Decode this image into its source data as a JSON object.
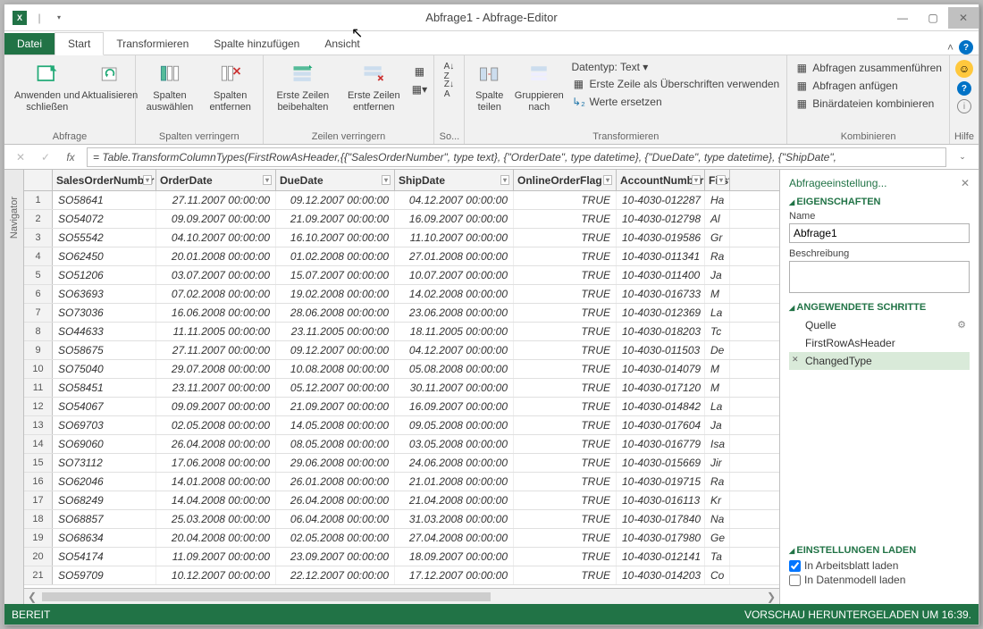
{
  "title": "Abfrage1 - Abfrage-Editor",
  "tabs": {
    "file": "Datei",
    "start": "Start",
    "transform": "Transformieren",
    "addcol": "Spalte hinzufügen",
    "view": "Ansicht"
  },
  "ribbon": {
    "group1": {
      "label": "Abfrage",
      "apply": "Anwenden\nund schließen",
      "refresh": "Aktualisieren"
    },
    "group2": {
      "label": "Spalten verringern",
      "choose": "Spalten\nauswählen",
      "remove": "Spalten\nentfernen"
    },
    "group3": {
      "label": "Zeilen verringern",
      "keep": "Erste Zeilen\nbeibehalten",
      "del": "Erste Zeilen\nentfernen"
    },
    "group4": {
      "label": "So..."
    },
    "group5": {
      "label": "Transformieren",
      "split": "Spalte\nteilen",
      "group": "Gruppieren\nnach",
      "dtype": "Datentyp: Text ▾",
      "firstrow": "Erste Zeile als Überschriften verwenden",
      "replace": "Werte ersetzen"
    },
    "group6": {
      "label": "Kombinieren",
      "merge": "Abfragen zusammenführen",
      "append": "Abfragen anfügen",
      "binary": "Binärdateien kombinieren"
    },
    "group7": {
      "label": "Hilfe"
    }
  },
  "formula": "= Table.TransformColumnTypes(FirstRowAsHeader,{{\"SalesOrderNumber\", type text}, {\"OrderDate\", type datetime}, {\"DueDate\", type datetime}, {\"ShipDate\",",
  "nav": "Navigator",
  "cols": [
    "SalesOrderNumber",
    "OrderDate",
    "DueDate",
    "ShipDate",
    "OnlineOrderFlag",
    "AccountNumber",
    "FirstN"
  ],
  "rows": [
    [
      "SO58641",
      "27.11.2007 00:00:00",
      "09.12.2007 00:00:00",
      "04.12.2007 00:00:00",
      "TRUE",
      "10-4030-012287",
      "Ha"
    ],
    [
      "SO54072",
      "09.09.2007 00:00:00",
      "21.09.2007 00:00:00",
      "16.09.2007 00:00:00",
      "TRUE",
      "10-4030-012798",
      "Al"
    ],
    [
      "SO55542",
      "04.10.2007 00:00:00",
      "16.10.2007 00:00:00",
      "11.10.2007 00:00:00",
      "TRUE",
      "10-4030-019586",
      "Gr"
    ],
    [
      "SO62450",
      "20.01.2008 00:00:00",
      "01.02.2008 00:00:00",
      "27.01.2008 00:00:00",
      "TRUE",
      "10-4030-011341",
      "Ra"
    ],
    [
      "SO51206",
      "03.07.2007 00:00:00",
      "15.07.2007 00:00:00",
      "10.07.2007 00:00:00",
      "TRUE",
      "10-4030-011400",
      "Ja"
    ],
    [
      "SO63693",
      "07.02.2008 00:00:00",
      "19.02.2008 00:00:00",
      "14.02.2008 00:00:00",
      "TRUE",
      "10-4030-016733",
      "M"
    ],
    [
      "SO73036",
      "16.06.2008 00:00:00",
      "28.06.2008 00:00:00",
      "23.06.2008 00:00:00",
      "TRUE",
      "10-4030-012369",
      "La"
    ],
    [
      "SO44633",
      "11.11.2005 00:00:00",
      "23.11.2005 00:00:00",
      "18.11.2005 00:00:00",
      "TRUE",
      "10-4030-018203",
      "Tc"
    ],
    [
      "SO58675",
      "27.11.2007 00:00:00",
      "09.12.2007 00:00:00",
      "04.12.2007 00:00:00",
      "TRUE",
      "10-4030-011503",
      "De"
    ],
    [
      "SO75040",
      "29.07.2008 00:00:00",
      "10.08.2008 00:00:00",
      "05.08.2008 00:00:00",
      "TRUE",
      "10-4030-014079",
      "M"
    ],
    [
      "SO58451",
      "23.11.2007 00:00:00",
      "05.12.2007 00:00:00",
      "30.11.2007 00:00:00",
      "TRUE",
      "10-4030-017120",
      "M"
    ],
    [
      "SO54067",
      "09.09.2007 00:00:00",
      "21.09.2007 00:00:00",
      "16.09.2007 00:00:00",
      "TRUE",
      "10-4030-014842",
      "La"
    ],
    [
      "SO69703",
      "02.05.2008 00:00:00",
      "14.05.2008 00:00:00",
      "09.05.2008 00:00:00",
      "TRUE",
      "10-4030-017604",
      "Ja"
    ],
    [
      "SO69060",
      "26.04.2008 00:00:00",
      "08.05.2008 00:00:00",
      "03.05.2008 00:00:00",
      "TRUE",
      "10-4030-016779",
      "Isa"
    ],
    [
      "SO73112",
      "17.06.2008 00:00:00",
      "29.06.2008 00:00:00",
      "24.06.2008 00:00:00",
      "TRUE",
      "10-4030-015669",
      "Jir"
    ],
    [
      "SO62046",
      "14.01.2008 00:00:00",
      "26.01.2008 00:00:00",
      "21.01.2008 00:00:00",
      "TRUE",
      "10-4030-019715",
      "Ra"
    ],
    [
      "SO68249",
      "14.04.2008 00:00:00",
      "26.04.2008 00:00:00",
      "21.04.2008 00:00:00",
      "TRUE",
      "10-4030-016113",
      "Kr"
    ],
    [
      "SO68857",
      "25.03.2008 00:00:00",
      "06.04.2008 00:00:00",
      "31.03.2008 00:00:00",
      "TRUE",
      "10-4030-017840",
      "Na"
    ],
    [
      "SO68634",
      "20.04.2008 00:00:00",
      "02.05.2008 00:00:00",
      "27.04.2008 00:00:00",
      "TRUE",
      "10-4030-017980",
      "Ge"
    ],
    [
      "SO54174",
      "11.09.2007 00:00:00",
      "23.09.2007 00:00:00",
      "18.09.2007 00:00:00",
      "TRUE",
      "10-4030-012141",
      "Ta"
    ],
    [
      "SO59709",
      "10.12.2007 00:00:00",
      "22.12.2007 00:00:00",
      "17.12.2007 00:00:00",
      "TRUE",
      "10-4030-014203",
      "Co"
    ]
  ],
  "side": {
    "title": "Abfrageeinstellung...",
    "props": "EIGENSCHAFTEN",
    "name_lbl": "Name",
    "name_val": "Abfrage1",
    "desc_lbl": "Beschreibung",
    "steps_h": "ANGEWENDETE SCHRITTE",
    "steps": [
      "Quelle",
      "FirstRowAsHeader",
      "ChangedType"
    ],
    "load_h": "EINSTELLUNGEN LADEN",
    "load1": "In Arbeitsblatt laden",
    "load2": "In Datenmodell laden"
  },
  "status": {
    "left": "BEREIT",
    "right": "VORSCHAU HERUNTERGELADEN UM 16:39."
  }
}
